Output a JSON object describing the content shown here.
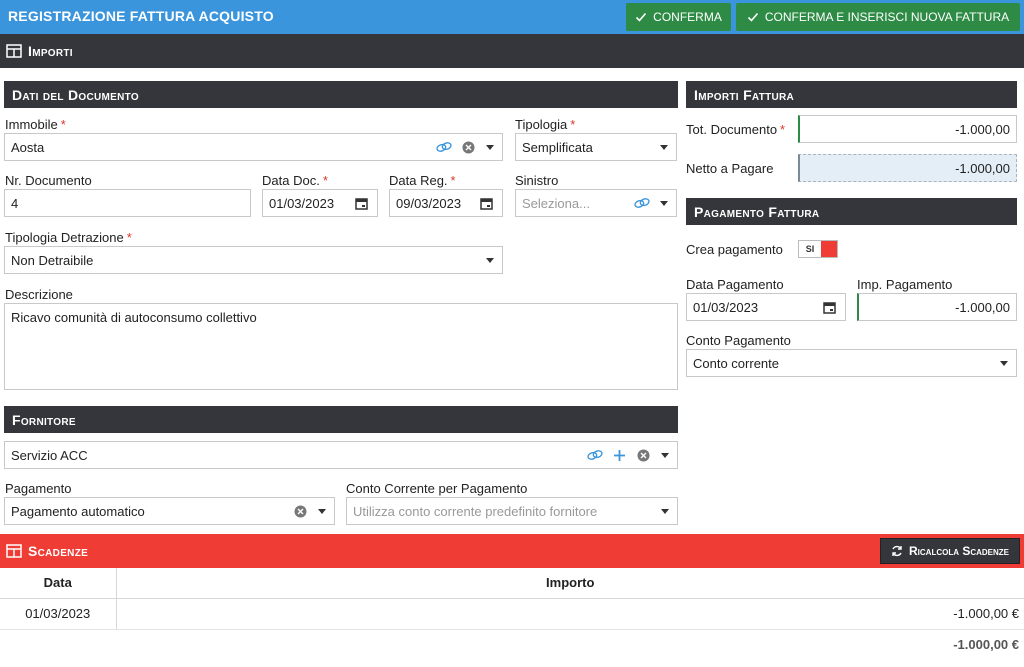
{
  "header": {
    "title": "REGISTRAZIONE FATTURA ACQUISTO",
    "confirm_label": "CONFERMA",
    "confirm_new_label": "CONFERMA E INSERISCI NUOVA FATTURA"
  },
  "importi_bar": {
    "label": "Importi"
  },
  "documento": {
    "section_title": "Dati del Documento",
    "immobile": {
      "label": "Immobile",
      "value": "Aosta"
    },
    "tipologia": {
      "label": "Tipologia",
      "value": "Semplificata"
    },
    "nr_documento": {
      "label": "Nr. Documento",
      "value": "4"
    },
    "data_doc": {
      "label": "Data Doc.",
      "value": "01/03/2023"
    },
    "data_reg": {
      "label": "Data Reg.",
      "value": "09/03/2023"
    },
    "sinistro": {
      "label": "Sinistro",
      "placeholder": "Seleziona..."
    },
    "tipologia_detrazione": {
      "label": "Tipologia Detrazione",
      "value": "Non Detraibile"
    },
    "descrizione": {
      "label": "Descrizione",
      "value": "Ricavo comunità di autoconsumo collettivo"
    }
  },
  "fornitore": {
    "section_title": "Fornitore",
    "value": "Servizio ACC",
    "pagamento": {
      "label": "Pagamento",
      "value": "Pagamento automatico"
    },
    "conto_corrente": {
      "label": "Conto Corrente per Pagamento",
      "placeholder": "Utilizza conto corrente predefinito fornitore"
    }
  },
  "importi_fattura": {
    "section_title": "Importi Fattura",
    "tot_documento": {
      "label": "Tot. Documento",
      "value": "-1.000,00"
    },
    "netto_pagare": {
      "label": "Netto a Pagare",
      "value": "-1.000,00"
    }
  },
  "pagamento_fattura": {
    "section_title": "Pagamento Fattura",
    "crea_pagamento": {
      "label": "Crea pagamento",
      "toggle_text": "SI",
      "on": true
    },
    "data_pagamento": {
      "label": "Data Pagamento",
      "value": "01/03/2023"
    },
    "imp_pagamento": {
      "label": "Imp. Pagamento",
      "value": "-1.000,00"
    },
    "conto_pagamento": {
      "label": "Conto Pagamento",
      "value": "Conto corrente"
    }
  },
  "scadenze": {
    "label": "Scadenze",
    "ricalcola_label": "Ricalcola Scadenze",
    "columns": [
      "Data",
      "Importo"
    ],
    "rows": [
      {
        "data": "01/03/2023",
        "importo": "-1.000,00 €"
      }
    ],
    "total": "-1.000,00 €"
  },
  "colors": {
    "topbar": "#3a95dc",
    "confirm": "#2e8b45",
    "dark": "#34363b",
    "scadenze": "#ef3c35",
    "required": "#d9362b"
  }
}
